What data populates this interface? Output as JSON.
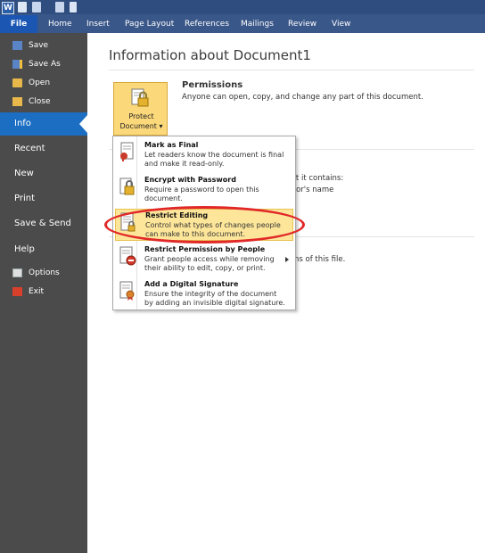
{
  "ribbon": {
    "tabs": [
      {
        "label": "File"
      },
      {
        "label": "Home"
      },
      {
        "label": "Insert"
      },
      {
        "label": "Page Layout"
      },
      {
        "label": "References"
      },
      {
        "label": "Mailings"
      },
      {
        "label": "Review"
      },
      {
        "label": "View"
      }
    ],
    "word_logo": "W"
  },
  "sidebar": {
    "commands_top": [
      {
        "label": "Save",
        "icon": "save-icon"
      },
      {
        "label": "Save As",
        "icon": "save-as-icon"
      },
      {
        "label": "Open",
        "icon": "folder-open-icon"
      },
      {
        "label": "Close",
        "icon": "close-document-icon"
      }
    ],
    "tabs": [
      {
        "label": "Info",
        "active": true
      },
      {
        "label": "Recent"
      },
      {
        "label": "New"
      },
      {
        "label": "Print"
      },
      {
        "label": "Save & Send"
      },
      {
        "label": "Help"
      }
    ],
    "commands_bottom": [
      {
        "label": "Options",
        "icon": "options-icon"
      },
      {
        "label": "Exit",
        "icon": "exit-icon"
      }
    ]
  },
  "info": {
    "title": "Information about Document1",
    "protect_button": {
      "line1": "Protect",
      "line2": "Document",
      "arrow": "▾"
    },
    "permissions": {
      "title": "Permissions",
      "description": "Anyone can open, copy, and change any part of this document."
    },
    "background_fragments": {
      "contains": "that it contains:",
      "authors": "uthor's name",
      "versions": "ns of this file."
    }
  },
  "protect_menu": {
    "items": [
      {
        "title": "Mark as Final",
        "desc1": "Let readers know the document is final",
        "desc2": "and make it read-only.",
        "icon": "mark-final-icon"
      },
      {
        "title": "Encrypt with Password",
        "desc1": "Require a password to open this",
        "desc2": "document.",
        "icon": "encrypt-lock-icon"
      },
      {
        "title": "Restrict Editing",
        "desc1": "Control what types of changes people",
        "desc2": "can make to this document.",
        "icon": "restrict-editing-icon",
        "highlighted": true
      },
      {
        "title": "Restrict Permission by People",
        "desc1": "Grant people access while removing",
        "desc2": "their ability to edit, copy, or print.",
        "icon": "restrict-permission-icon",
        "has_submenu": true
      },
      {
        "title": "Add a Digital Signature",
        "desc1": "Ensure the integrity of the document",
        "desc2": "by adding an invisible digital signature.",
        "icon": "digital-signature-icon"
      }
    ]
  },
  "colors": {
    "ribbon": "#3a5789",
    "file_tab": "#1b56b3",
    "sidebar": "#4b4b4b",
    "active_tab": "#1b6ec2",
    "highlight": "#fde69a",
    "annotation": "#e12828"
  }
}
